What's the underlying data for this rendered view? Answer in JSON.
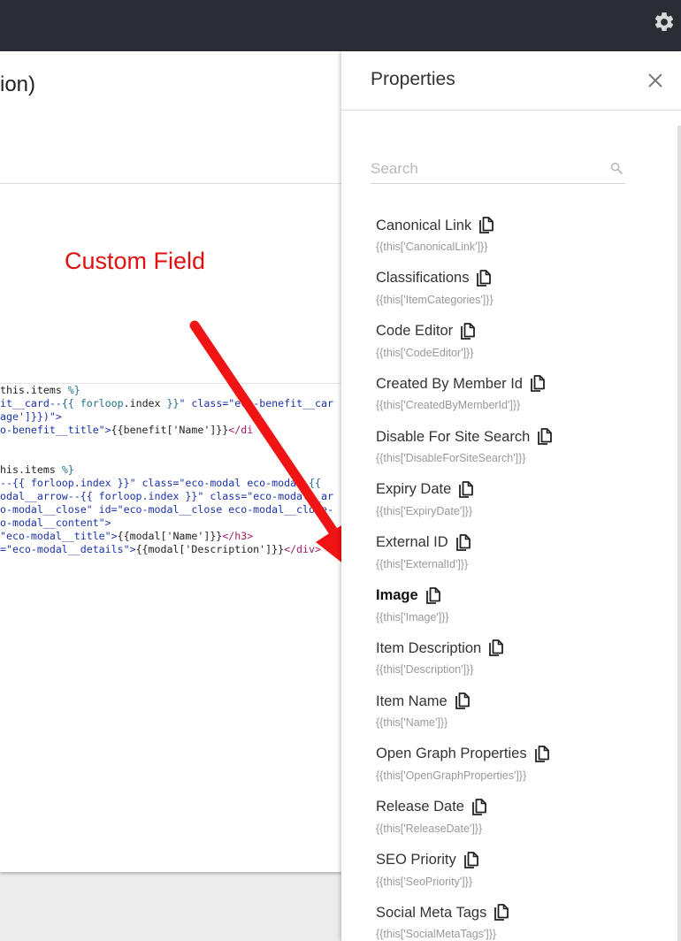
{
  "topbar": {
    "settings_icon": "gear-icon"
  },
  "editor": {
    "heading": "ion)",
    "annotation": "Custom Field",
    "annotation_color": "#e01010",
    "code_lines": [
      [
        {
          "t": "this.items ",
          "c": "c-def"
        },
        {
          "t": "%}",
          "c": "c-tpl"
        }
      ],
      [
        {
          "t": "it__card--",
          "c": "c-str"
        },
        {
          "t": "{{ forloop",
          "c": "c-tpl"
        },
        {
          "t": ".index ",
          "c": "c-def"
        },
        {
          "t": "}}",
          "c": "c-tpl"
        },
        {
          "t": "\" class=\"",
          "c": "c-str"
        },
        {
          "t": "eco-benefit__car",
          "c": "c-str"
        }
      ],
      [
        {
          "t": "age']}})\">",
          "c": "c-str"
        }
      ],
      [
        {
          "t": "o-benefit__title\">",
          "c": "c-str"
        },
        {
          "t": "{{benefit['Name']}}",
          "c": "c-def"
        },
        {
          "t": "</di",
          "c": "c-tag"
        }
      ],
      [
        {
          "t": "",
          "c": "c-def"
        }
      ],
      [
        {
          "t": "",
          "c": "c-def"
        }
      ],
      [
        {
          "t": "his.items ",
          "c": "c-def"
        },
        {
          "t": "%}",
          "c": "c-tpl"
        }
      ],
      [
        {
          "t": "--{{ forloop.index }}\" class=\"eco-modal eco-moda",
          "c": "c-str"
        },
        {
          "t": "--{{",
          "c": "c-tpl"
        }
      ],
      [
        {
          "t": "odal__arrow--{{ forloop.index }}\" class=\"eco-modal__ar",
          "c": "c-str"
        }
      ],
      [
        {
          "t": "o-modal__close\" id=\"eco-modal__close eco-modal__close-",
          "c": "c-str"
        }
      ],
      [
        {
          "t": "o-modal__content\">",
          "c": "c-str"
        }
      ],
      [
        {
          "t": "\"eco-modal__title\">",
          "c": "c-str"
        },
        {
          "t": "{{modal['Name']}}",
          "c": "c-def"
        },
        {
          "t": "</h3>",
          "c": "c-tag"
        }
      ],
      [
        {
          "t": "=\"eco-modal__details\">",
          "c": "c-str"
        },
        {
          "t": "{{modal['Description']}}",
          "c": "c-def"
        },
        {
          "t": "</div>",
          "c": "c-tag"
        }
      ]
    ]
  },
  "panel": {
    "title": "Properties",
    "close_icon": "close-icon",
    "search": {
      "placeholder": "Search",
      "value": ""
    },
    "properties": [
      {
        "name": "Canonical Link",
        "expr": "{{this['CanonicalLink']}}",
        "bold": false
      },
      {
        "name": "Classifications",
        "expr": "{{this['ItemCategories']}}",
        "bold": false
      },
      {
        "name": "Code Editor",
        "expr": "{{this['CodeEditor']}}",
        "bold": false
      },
      {
        "name": "Created By Member Id",
        "expr": "{{this['CreatedByMemberId']}}",
        "bold": false
      },
      {
        "name": "Disable For Site Search",
        "expr": "{{this['DisableForSiteSearch']}}",
        "bold": false
      },
      {
        "name": "Expiry Date",
        "expr": "{{this['ExpiryDate']}}",
        "bold": false
      },
      {
        "name": "External ID",
        "expr": "{{this['ExternalId']}}",
        "bold": false
      },
      {
        "name": "Image",
        "expr": "{{this['Image']}}",
        "bold": true
      },
      {
        "name": "Item Description",
        "expr": "{{this['Description']}}",
        "bold": false
      },
      {
        "name": "Item Name",
        "expr": "{{this['Name']}}",
        "bold": false
      },
      {
        "name": "Open Graph Properties",
        "expr": "{{this['OpenGraphProperties']}}",
        "bold": false
      },
      {
        "name": "Release Date",
        "expr": "{{this['ReleaseDate']}}",
        "bold": false
      },
      {
        "name": "SEO Priority",
        "expr": "{{this['SeoPriority']}}",
        "bold": false
      },
      {
        "name": "Social Meta Tags",
        "expr": "{{this['SocialMetaTags']}}",
        "bold": false
      }
    ]
  }
}
